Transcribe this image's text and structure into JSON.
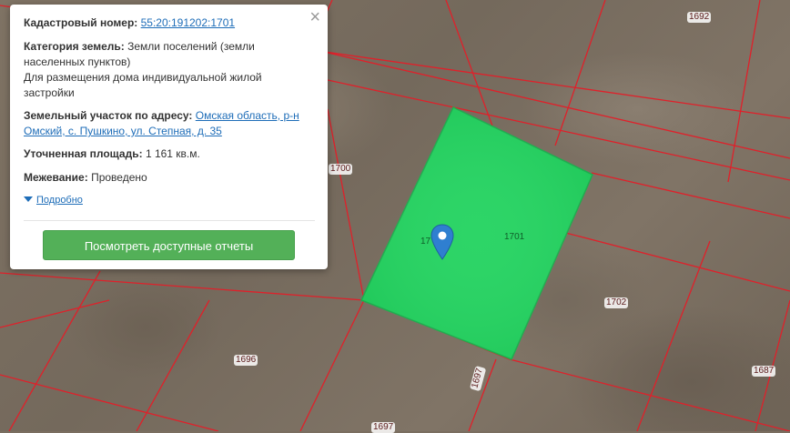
{
  "popup": {
    "close_glyph": "×",
    "cadastral_label": "Кадастровый номер:",
    "cadastral_value": "55:20:191202:1701",
    "category_label": "Категория земель:",
    "category_value": "Земли поселений (земли населенных пунктов)",
    "category_usage": "Для размещения дома индивидуальной жилой застройки",
    "address_label": "Земельный участок по адресу:",
    "address_value": "Омская область, р-н Омский, с. Пушкино, ул. Степная, д. 35",
    "area_label": "Уточненная площадь:",
    "area_value": "1 161 кв.м.",
    "survey_label": "Межевание:",
    "survey_value": "Проведено",
    "details_link": "Подробно",
    "reports_button": "Посмотреть доступные отчеты"
  },
  "map": {
    "parcel_labels": {
      "p1692": "1692",
      "p1700": "1700",
      "p1701": "1701",
      "p1701_partial": "17",
      "p1702": "1702",
      "p1696": "1696",
      "p1697": "1697",
      "p1687": "1687",
      "p1697b": "1697"
    },
    "colors": {
      "selected_parcel": "#22d35f",
      "boundary": "#e0202a",
      "marker": "#2f7fd0",
      "button": "#53b058"
    }
  }
}
